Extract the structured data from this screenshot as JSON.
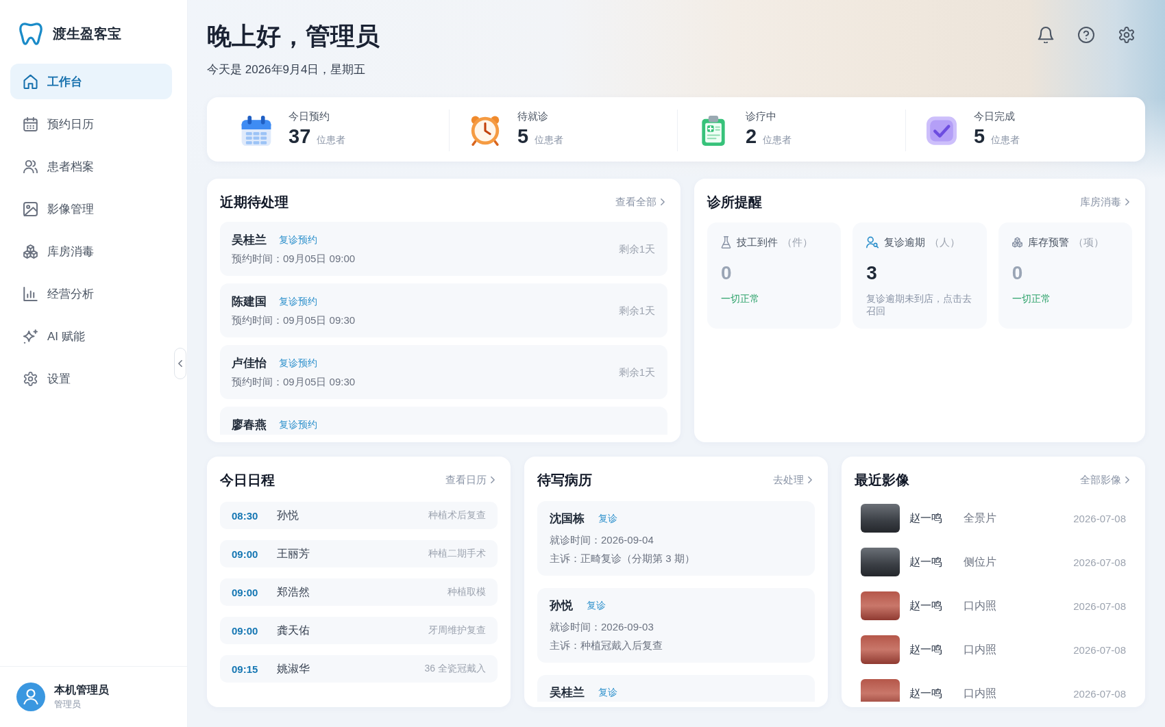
{
  "sidebar": {
    "brand": "渡生盈客宝",
    "items": [
      {
        "label": "工作台",
        "selected": true
      },
      {
        "label": "预约日历",
        "selected": false
      },
      {
        "label": "患者档案",
        "selected": false
      },
      {
        "label": "影像管理",
        "selected": false
      },
      {
        "label": "库房消毒",
        "selected": false
      },
      {
        "label": "经营分析",
        "selected": false
      },
      {
        "label": "AI 赋能",
        "selected": false
      },
      {
        "label": "设置",
        "selected": false
      }
    ],
    "user": {
      "name": "本机管理员",
      "role": "管理员"
    }
  },
  "header": {
    "greeting": "晚上好，管理员",
    "date_line": "今天是 2026年9月4日，星期五"
  },
  "stats": [
    {
      "label": "今日预约",
      "value": "37",
      "unit": "位患者"
    },
    {
      "label": "待就诊",
      "value": "5",
      "unit": "位患者"
    },
    {
      "label": "诊疗中",
      "value": "2",
      "unit": "位患者"
    },
    {
      "label": "今日完成",
      "value": "5",
      "unit": "位患者"
    }
  ],
  "pending": {
    "title": "近期待处理",
    "link": "查看全部",
    "items": [
      {
        "name": "吴桂兰",
        "tag": "复诊预约",
        "time": "预约时间：09月05日 09:00",
        "remaining": "剩余1天"
      },
      {
        "name": "陈建国",
        "tag": "复诊预约",
        "time": "预约时间：09月05日 09:30",
        "remaining": "剩余1天"
      },
      {
        "name": "卢佳怡",
        "tag": "复诊预约",
        "time": "预约时间：09月05日 09:30",
        "remaining": "剩余1天"
      },
      {
        "name": "廖春燕",
        "tag": "复诊预约"
      }
    ]
  },
  "reminders": {
    "title": "诊所提醒",
    "link": "库房消毒",
    "items": [
      {
        "label": "技工到件",
        "unit": "（件）",
        "value": "0",
        "note": "一切正常",
        "alert": false
      },
      {
        "label": "复诊逾期",
        "unit": "（人）",
        "value": "3",
        "note": "复诊逾期未到店，点击去召回",
        "alert": true
      },
      {
        "label": "库存预警",
        "unit": "（项）",
        "value": "0",
        "note": "一切正常",
        "alert": false
      }
    ]
  },
  "schedule": {
    "title": "今日日程",
    "link": "查看日历",
    "items": [
      {
        "time": "08:30",
        "name": "孙悦",
        "procedure": "种植术后复查"
      },
      {
        "time": "09:00",
        "name": "王丽芳",
        "procedure": "种植二期手术"
      },
      {
        "time": "09:00",
        "name": "郑浩然",
        "procedure": "种植取模"
      },
      {
        "time": "09:00",
        "name": "龚天佑",
        "procedure": "牙周维护复查"
      },
      {
        "time": "09:15",
        "name": "姚淑华",
        "procedure": "36 全瓷冠戴入"
      }
    ]
  },
  "records": {
    "title": "待写病历",
    "link": "去处理",
    "items": [
      {
        "name": "沈国栋",
        "tag": "复诊",
        "visit": "就诊时间：2026-09-04",
        "complaint": "主诉：正畸复诊（分期第 3 期）"
      },
      {
        "name": "孙悦",
        "tag": "复诊",
        "visit": "就诊时间：2026-09-03",
        "complaint": "主诉：种植冠戴入后复查"
      },
      {
        "name": "吴桂兰",
        "tag": "复诊"
      }
    ]
  },
  "images": {
    "title": "最近影像",
    "link": "全部影像",
    "items": [
      {
        "patient": "赵一鸣",
        "type": "全景片",
        "date": "2026-07-08",
        "kind": "xray"
      },
      {
        "patient": "赵一鸣",
        "type": "侧位片",
        "date": "2026-07-08",
        "kind": "xray"
      },
      {
        "patient": "赵一鸣",
        "type": "口内照",
        "date": "2026-07-08",
        "kind": "photo"
      },
      {
        "patient": "赵一鸣",
        "type": "口内照",
        "date": "2026-07-08",
        "kind": "photo"
      },
      {
        "patient": "赵一鸣",
        "type": "口内照",
        "date": "2026-07-08",
        "kind": "photo"
      }
    ]
  }
}
